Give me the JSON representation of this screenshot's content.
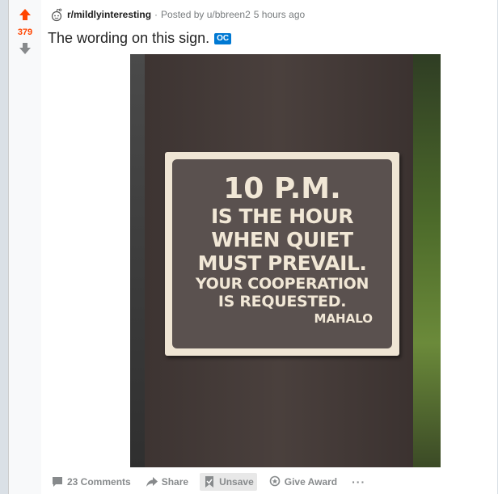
{
  "vote": {
    "score": "379",
    "accent": "#ff4500"
  },
  "meta": {
    "subreddit": "r/mildlyinteresting",
    "separator": "·",
    "posted_by": "Posted by u/bbreen2",
    "time": "5 hours ago"
  },
  "post": {
    "title": "The wording on this sign.",
    "flair": "OC",
    "flair_color": "#0079d3"
  },
  "image": {
    "sign_lines": [
      "10 P.M.",
      "IS THE HOUR",
      "WHEN QUIET",
      "MUST PREVAIL.",
      "YOUR COOPERATION",
      "IS REQUESTED.",
      "MAHALO"
    ]
  },
  "actions": {
    "comments": "23 Comments",
    "share": "Share",
    "unsave": "Unsave",
    "give_award": "Give Award",
    "more": "···"
  },
  "icons": {
    "upvote": "arrow-up-icon",
    "downvote": "arrow-down-icon",
    "subreddit": "reddit-alien-icon",
    "comments": "comment-icon",
    "share": "share-arrow-icon",
    "unsave": "bookmark-icon",
    "award": "award-icon"
  }
}
